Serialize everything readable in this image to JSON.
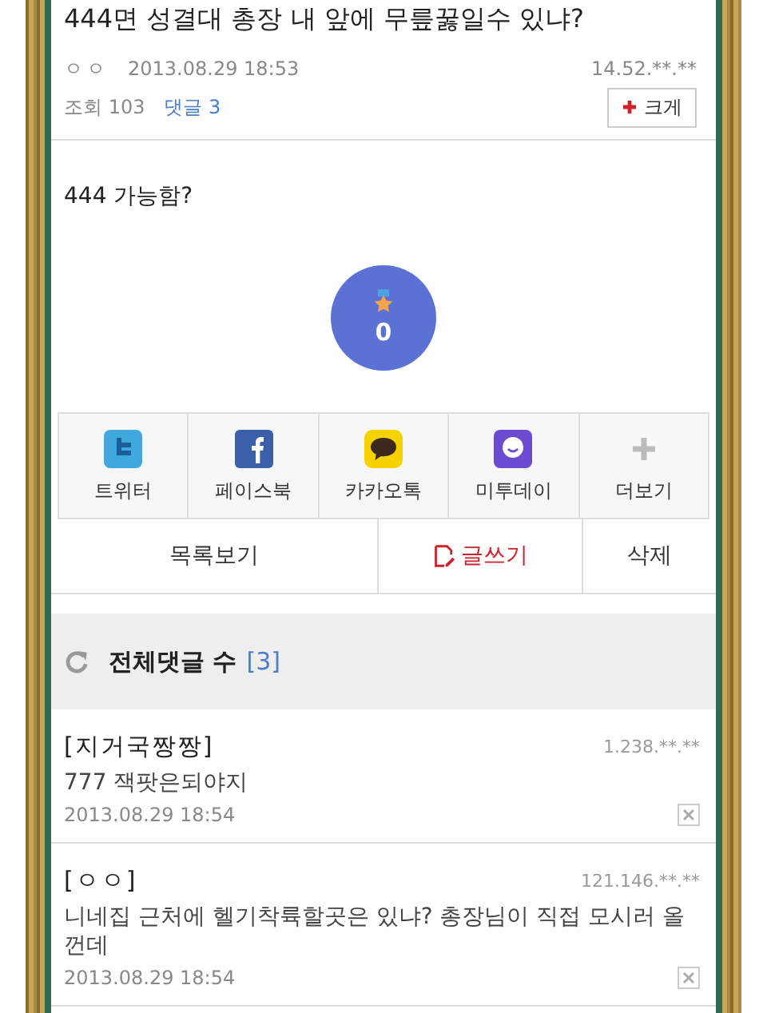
{
  "post": {
    "title": "444면 성결대 총장 내 앞에 무릎꿇일수 있냐?",
    "author": "ㅇㅇ",
    "date": "2013.08.29 18:53",
    "ip": "14.52.**.**",
    "views": "조회 103",
    "comments_link": "댓글 3",
    "enlarge": "크게",
    "body": "444 가능함?",
    "recommend_count": "0"
  },
  "share": [
    {
      "kind": "twitter",
      "label": "트위터"
    },
    {
      "kind": "facebook",
      "label": "페이스북"
    },
    {
      "kind": "kakao",
      "label": "카카오톡"
    },
    {
      "kind": "metoday",
      "label": "미투데이"
    },
    {
      "kind": "more",
      "label": "더보기"
    }
  ],
  "actions": {
    "list": "목록보기",
    "write": "글쓰기",
    "delete": "삭제"
  },
  "comments_header": {
    "label": "전체댓글 수",
    "count": "[3]"
  },
  "comments": [
    {
      "author": "[지거국짱짱]",
      "ip": "1.238.**.**",
      "text": "777 잭팟은되야지",
      "date": "2013.08.29 18:54"
    },
    {
      "author": "[ㅇㅇ]",
      "ip": "121.146.**.**",
      "text": "니네집 근처에 헬기착륙할곳은 있냐? 총장님이 직접 모시러 올껀데",
      "date": "2013.08.29 18:54"
    }
  ]
}
